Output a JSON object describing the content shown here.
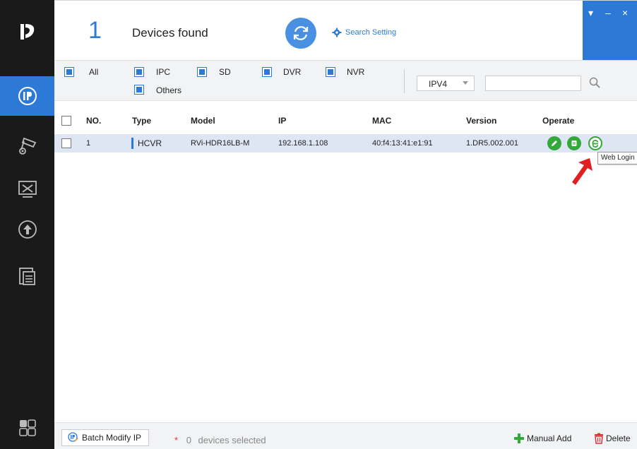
{
  "header": {
    "count": "1",
    "found_label": "Devices found",
    "search_setting_label": "Search Setting",
    "win_controls": {
      "menu": "▾",
      "minimize": "–",
      "close": "×"
    }
  },
  "filters": {
    "types": [
      {
        "label": "All",
        "checked": true
      },
      {
        "label": "IPC",
        "checked": true
      },
      {
        "label": "SD",
        "checked": true
      },
      {
        "label": "DVR",
        "checked": true
      },
      {
        "label": "NVR",
        "checked": true
      },
      {
        "label": "Others",
        "checked": true
      }
    ],
    "ip_version": "IPV4",
    "search_value": ""
  },
  "table": {
    "columns": [
      "NO.",
      "Type",
      "Model",
      "IP",
      "MAC",
      "Version",
      "Operate"
    ],
    "rows": [
      {
        "no": "1",
        "type": "HCVR",
        "model": "RVi-HDR16LB-M",
        "ip": "192.168.1.108",
        "mac": "40:f4:13:41:e1:91",
        "version": "1.DR5.002.001"
      }
    ]
  },
  "tooltip": "Web Login",
  "footer": {
    "batch_label": "Batch Modify IP",
    "star": "*",
    "selected_count": "0",
    "selected_label": "devices selected",
    "manual_add_label": "Manual Add",
    "delete_label": "Delete"
  },
  "colors": {
    "accent": "#2d7ad6",
    "sidebar": "#1a1a1a",
    "operate_green": "#35a83b",
    "annotation_red": "#e02020"
  }
}
